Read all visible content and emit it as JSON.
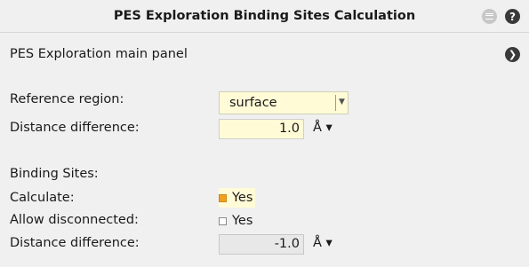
{
  "window": {
    "title": "PES Exploration Binding Sites Calculation"
  },
  "panel": {
    "main_label": "PES Exploration main panel"
  },
  "reference_region": {
    "label": "Reference region:",
    "value": "surface"
  },
  "distance_difference": {
    "label": "Distance difference:",
    "value": "1.0",
    "unit": "Å ▾"
  },
  "binding_sites": {
    "heading": "Binding Sites:",
    "calculate": {
      "label": "Calculate:",
      "option": "Yes",
      "checked": true
    },
    "allow_disconnected": {
      "label": "Allow disconnected:",
      "option": "Yes",
      "checked": false
    },
    "distance_difference": {
      "label": "Distance difference:",
      "value": "-1.0",
      "unit": "Å ▾"
    }
  },
  "colors": {
    "active_field": "#fffbd6",
    "checkbox_on": "#f0a020",
    "dark_button": "#3a3a3a"
  }
}
